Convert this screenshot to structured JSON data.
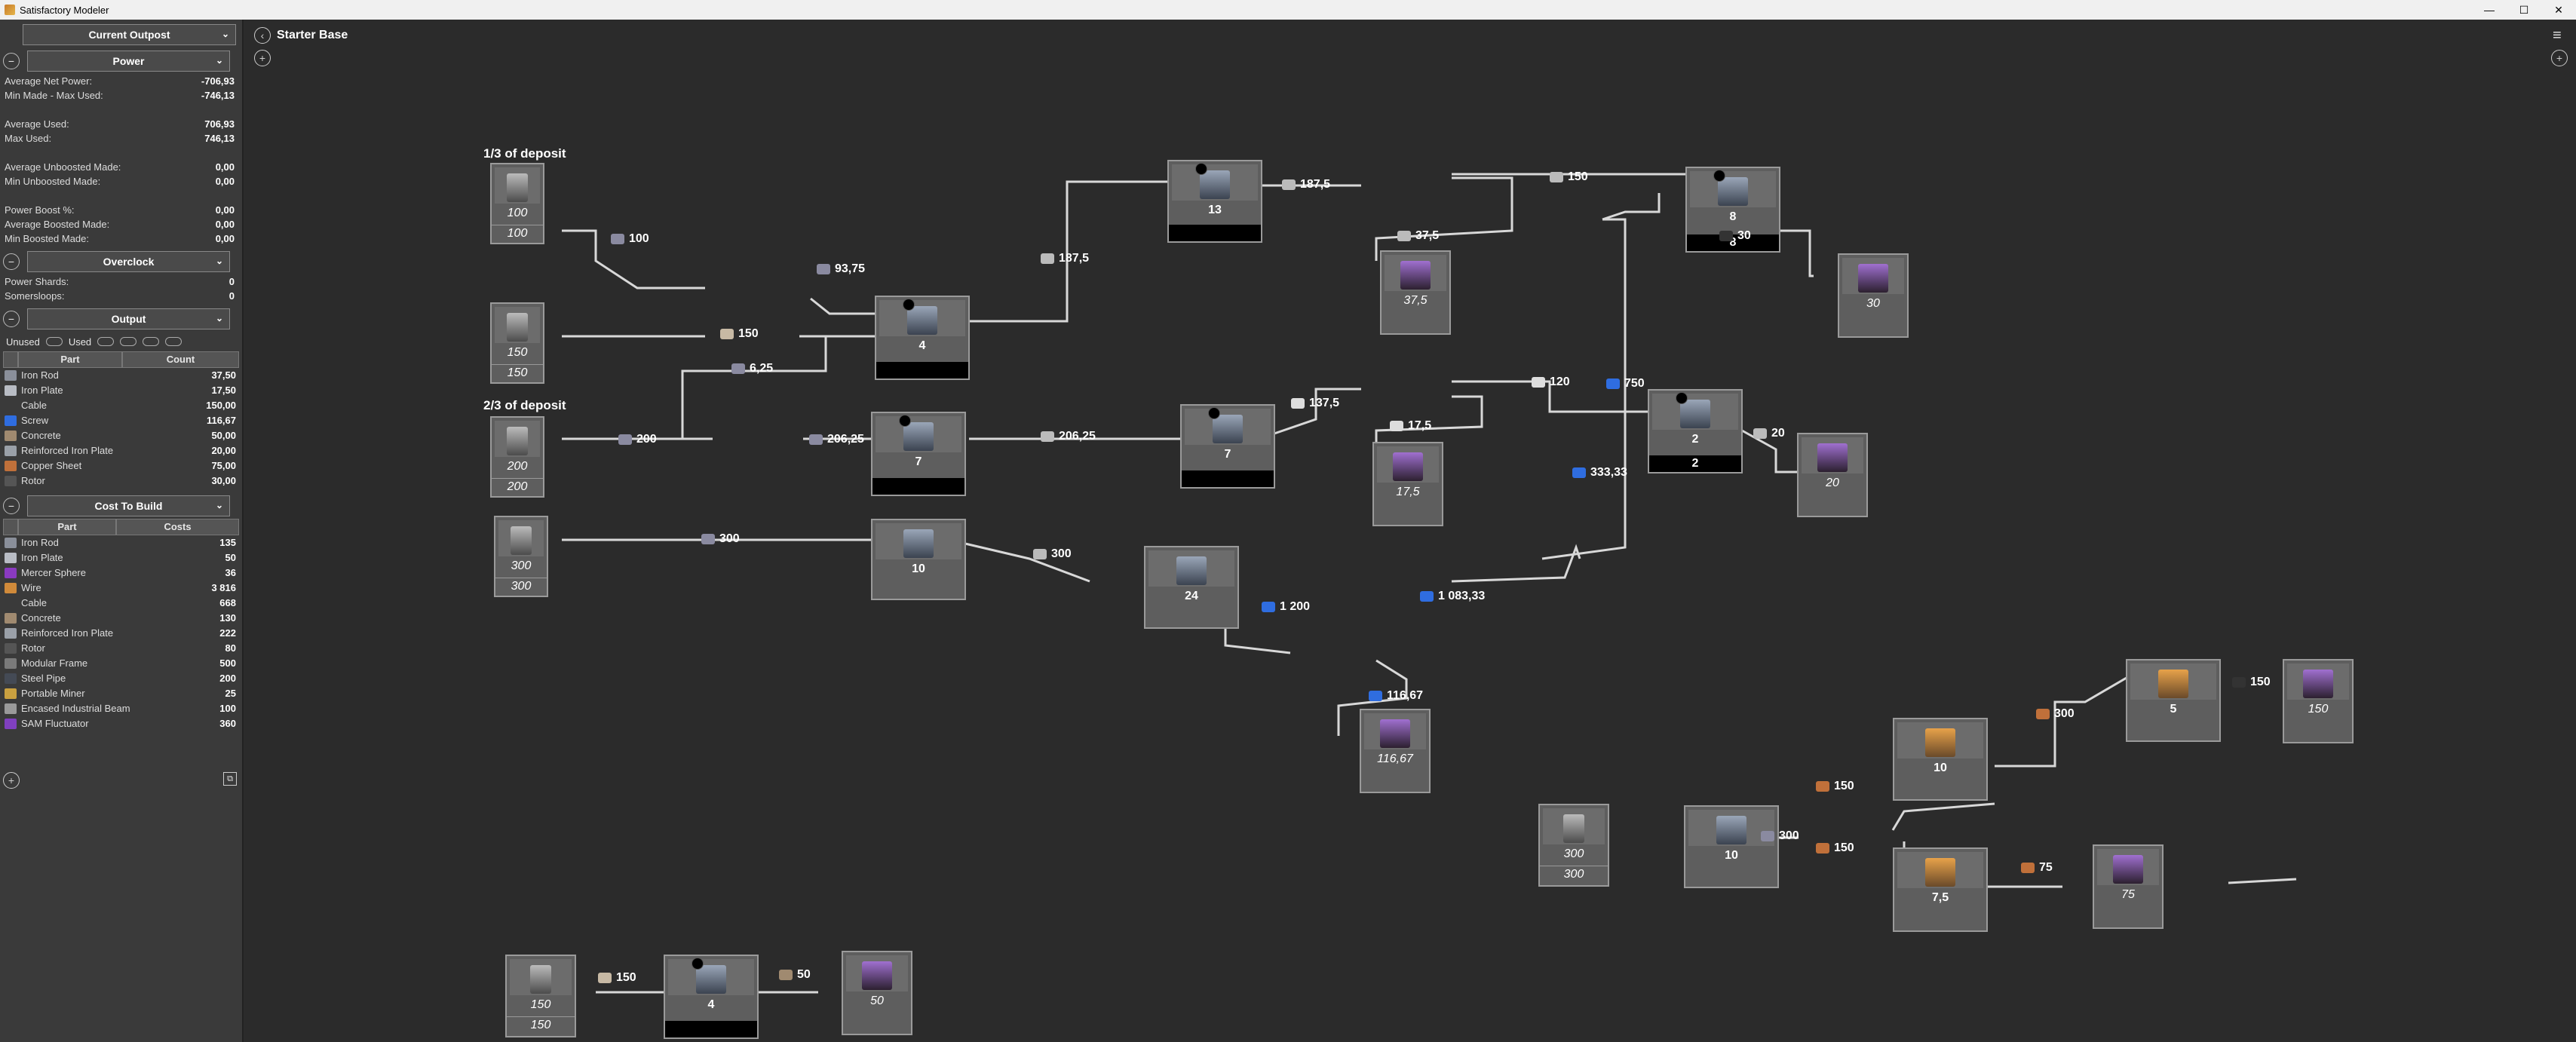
{
  "app": {
    "title": "Satisfactory Modeler"
  },
  "sidebar": {
    "outpost_dropdown": "Current Outpost",
    "power": {
      "dropdown": "Power",
      "rows": [
        {
          "label": "Average Net Power:",
          "value": "-706,93"
        },
        {
          "label": "Min Made - Max Used:",
          "value": "-746,13"
        },
        null,
        {
          "label": "Average Used:",
          "value": "706,93"
        },
        {
          "label": "Max Used:",
          "value": "746,13"
        },
        null,
        {
          "label": "Average Unboosted Made:",
          "value": "0,00"
        },
        {
          "label": "Min Unboosted Made:",
          "value": "0,00"
        },
        null,
        {
          "label": "Power Boost %:",
          "value": "0,00"
        },
        {
          "label": "Average Boosted Made:",
          "value": "0,00"
        },
        {
          "label": "Min Boosted Made:",
          "value": "0,00"
        }
      ]
    },
    "overclock": {
      "dropdown": "Overclock",
      "rows": [
        {
          "label": "Power Shards:",
          "value": "0"
        },
        {
          "label": "Somersloops:",
          "value": "0"
        }
      ]
    },
    "output": {
      "dropdown": "Output",
      "unused_label": "Unused",
      "used_label": "Used",
      "col_part": "Part",
      "col_count": "Count",
      "rows": [
        {
          "name": "Iron Rod",
          "value": "37,50",
          "color": "#8a8f9a"
        },
        {
          "name": "Iron Plate",
          "value": "17,50",
          "color": "#b8bcc4"
        },
        {
          "name": "Cable",
          "value": "150,00",
          "color": "#3a3a3a"
        },
        {
          "name": "Screw",
          "value": "116,67",
          "color": "#2f6de0"
        },
        {
          "name": "Concrete",
          "value": "50,00",
          "color": "#a08a70"
        },
        {
          "name": "Reinforced Iron Plate",
          "value": "20,00",
          "color": "#9aa0a8"
        },
        {
          "name": "Copper Sheet",
          "value": "75,00",
          "color": "#c0703a"
        },
        {
          "name": "Rotor",
          "value": "30,00",
          "color": "#555555"
        }
      ]
    },
    "cost": {
      "dropdown": "Cost To Build",
      "col_part": "Part",
      "col_costs": "Costs",
      "rows": [
        {
          "name": "Iron Rod",
          "value": "135",
          "color": "#8a8f9a"
        },
        {
          "name": "Iron Plate",
          "value": "50",
          "color": "#b8bcc4"
        },
        {
          "name": "Mercer Sphere",
          "value": "36",
          "color": "#8a3ac0"
        },
        {
          "name": "Wire",
          "value": "3 816",
          "color": "#d08a3a"
        },
        {
          "name": "Cable",
          "value": "668",
          "color": "#3a3a3a"
        },
        {
          "name": "Concrete",
          "value": "130",
          "color": "#a08a70"
        },
        {
          "name": "Reinforced Iron Plate",
          "value": "222",
          "color": "#9aa0a8"
        },
        {
          "name": "Rotor",
          "value": "80",
          "color": "#555555"
        },
        {
          "name": "Modular Frame",
          "value": "500",
          "color": "#7a7a7a"
        },
        {
          "name": "Steel Pipe",
          "value": "200",
          "color": "#444a55"
        },
        {
          "name": "Portable Miner",
          "value": "25",
          "color": "#c9a040"
        },
        {
          "name": "Encased Industrial Beam",
          "value": "100",
          "color": "#9a9a9a"
        },
        {
          "name": "SAM Fluctuator",
          "value": "360",
          "color": "#8040c0"
        }
      ]
    }
  },
  "canvas": {
    "title": "Starter Base",
    "labels": {
      "deposit_a": "1/3 of deposit",
      "deposit_b": "2/3 of deposit"
    },
    "nodes": {
      "m100": {
        "a": "100",
        "b": "100"
      },
      "m150": {
        "a": "150",
        "b": "150"
      },
      "m200": {
        "a": "200",
        "b": "200"
      },
      "m300": {
        "a": "300",
        "b": "300"
      },
      "ctor4": {
        "a": "4"
      },
      "ctor7": {
        "a": "7"
      },
      "ctor10": {
        "a": "10"
      },
      "ctor13": {
        "a": "13"
      },
      "s37": {
        "a": "37,5"
      },
      "as8": {
        "a": "8",
        "b": "8"
      },
      "s30": {
        "a": "30"
      },
      "ctor7b": {
        "a": "7"
      },
      "s17": {
        "a": "17,5"
      },
      "as2": {
        "a": "2",
        "b": "2"
      },
      "s20": {
        "a": "20"
      },
      "ctor24": {
        "a": "24"
      },
      "s116": {
        "a": "116,67"
      },
      "m300b": {
        "a": "300",
        "b": "300"
      },
      "ctor10b": {
        "a": "10"
      },
      "ctor10c": {
        "a": "10"
      },
      "ctor75": {
        "a": "7,5"
      },
      "s75": {
        "a": "75"
      },
      "ctor5": {
        "a": "5"
      },
      "s150": {
        "a": "150"
      },
      "m150b": {
        "a": "150",
        "b": "150"
      },
      "ctor4b": {
        "a": "4"
      },
      "s50": {
        "a": "50"
      }
    },
    "flows": {
      "f100": "100",
      "f150": "150",
      "f9375": "93,75",
      "f625": "6,25",
      "f200": "200",
      "f20625a": "206,25",
      "f1875a": "187,5",
      "f1875b": "187,5",
      "f375": "37,5",
      "f150b": "150",
      "f30": "30",
      "f20625b": "206,25",
      "f1375": "137,5",
      "f175": "17,5",
      "f120": "120",
      "f750": "750",
      "f20": "20",
      "f33333": "333,33",
      "f300": "300",
      "f300b": "300",
      "f1200": "1 200",
      "f108333": "1 083,33",
      "f11667": "116,67",
      "f300c": "300",
      "f150c": "150",
      "f150d": "150",
      "f75": "75",
      "f300d": "300",
      "f150e": "150",
      "f150f": "150",
      "f50": "50"
    }
  }
}
